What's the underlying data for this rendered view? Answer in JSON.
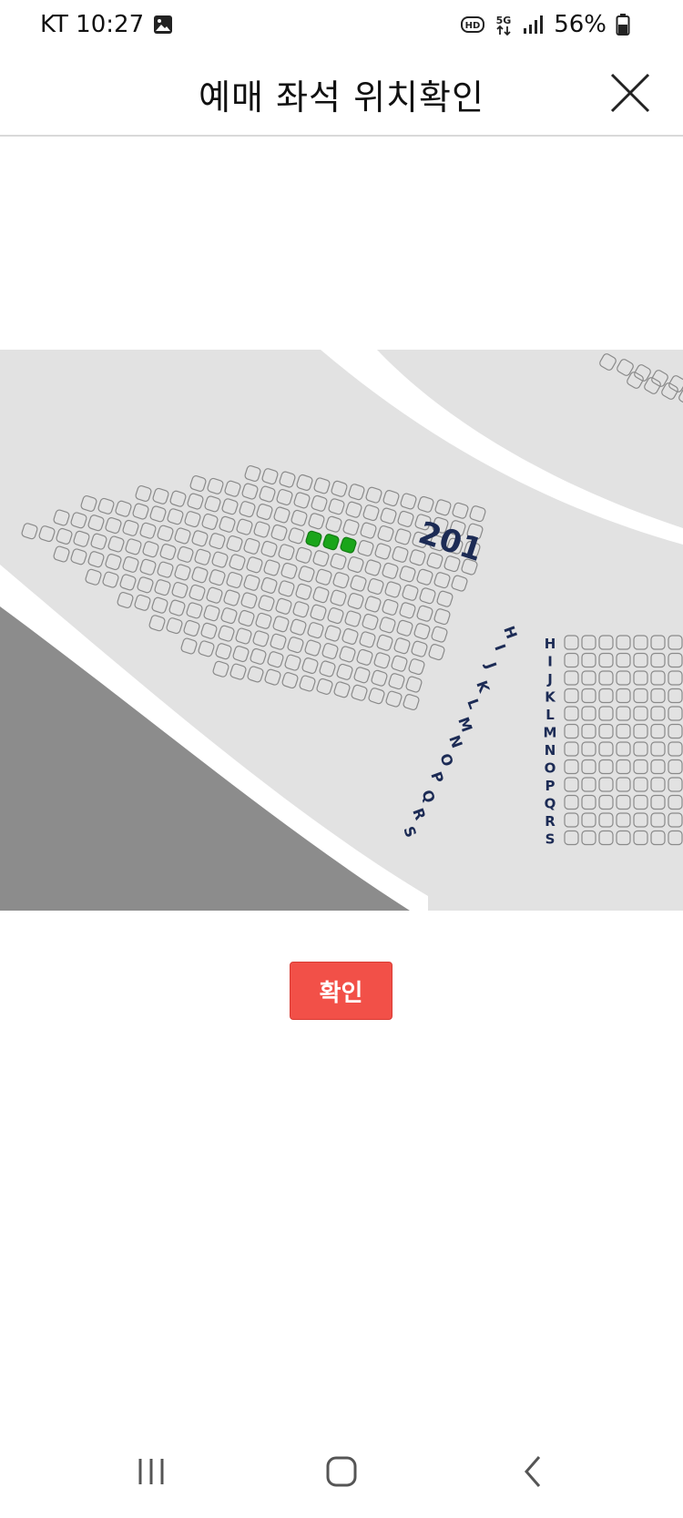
{
  "status_bar": {
    "carrier_time": "KT 10:27",
    "battery": "56%",
    "icons": [
      "gallery-icon",
      "hd-icon",
      "5g-icon",
      "signal-icon",
      "battery-icon"
    ]
  },
  "header": {
    "title": "예매 좌석 위치확인",
    "close_icon": "close-icon"
  },
  "seat_map": {
    "section_label": "201",
    "left_block_rows": [
      "H",
      "I",
      "J",
      "K",
      "L",
      "M",
      "N",
      "O",
      "P",
      "Q",
      "R",
      "S"
    ],
    "right_block_rows": [
      "H",
      "I",
      "J",
      "K",
      "L",
      "M",
      "N",
      "O",
      "P",
      "Q",
      "R",
      "S"
    ],
    "selected_seat_count": 3,
    "colors": {
      "selected": "#1aa51a",
      "seat_outline": "#8a8a8a",
      "label": "#1c2b55",
      "background": "#e2e2e2",
      "aisle": "#ffffff",
      "floor": "#8c8c8c"
    }
  },
  "confirm_button": {
    "label": "확인",
    "color": "#f25048"
  },
  "nav_bar": {
    "icons": [
      "recent-apps-icon",
      "home-icon",
      "back-icon"
    ]
  }
}
